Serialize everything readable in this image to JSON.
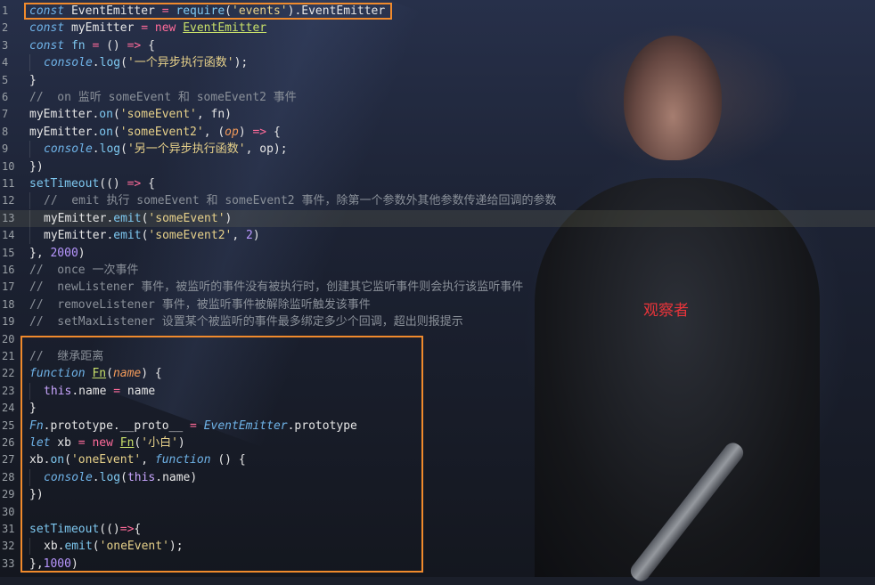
{
  "annotation": {
    "label": "观察者",
    "box_color": "#f08a2c",
    "label_color": "#e8343a"
  },
  "lines": [
    {
      "n": "1",
      "tokens": [
        [
          "kw",
          "const"
        ],
        [
          "code",
          " EventEmitter "
        ],
        [
          "op",
          "="
        ],
        [
          "code",
          " "
        ],
        [
          "fn",
          "require"
        ],
        [
          "code",
          "("
        ],
        [
          "str",
          "'events'"
        ],
        [
          "code",
          ").EventEmitter"
        ]
      ]
    },
    {
      "n": "2",
      "tokens": [
        [
          "kw",
          "const"
        ],
        [
          "code",
          " myEmitter "
        ],
        [
          "op",
          "="
        ],
        [
          "code",
          " "
        ],
        [
          "op",
          "new"
        ],
        [
          "code",
          " "
        ],
        [
          "cls",
          "EventEmitter"
        ]
      ]
    },
    {
      "n": "3",
      "tokens": [
        [
          "kw",
          "const"
        ],
        [
          "fn",
          " fn"
        ],
        [
          "code",
          " "
        ],
        [
          "op",
          "="
        ],
        [
          "code",
          " () "
        ],
        [
          "op",
          "=>"
        ],
        [
          "code",
          " {"
        ]
      ]
    },
    {
      "n": "4",
      "indent": 1,
      "tokens": [
        [
          "kw",
          "console"
        ],
        [
          "code",
          "."
        ],
        [
          "fn",
          "log"
        ],
        [
          "code",
          "("
        ],
        [
          "str",
          "'一个异步执行函数'"
        ],
        [
          "code",
          ");"
        ]
      ]
    },
    {
      "n": "5",
      "tokens": [
        [
          "code",
          "}"
        ]
      ]
    },
    {
      "n": "6",
      "tokens": [
        [
          "cm",
          "//  on 监听 someEvent 和 someEvent2 事件"
        ]
      ]
    },
    {
      "n": "7",
      "tokens": [
        [
          "code",
          "myEmitter."
        ],
        [
          "fn",
          "on"
        ],
        [
          "code",
          "("
        ],
        [
          "str",
          "'someEvent'"
        ],
        [
          "code",
          ", fn)"
        ]
      ]
    },
    {
      "n": "8",
      "tokens": [
        [
          "code",
          "myEmitter."
        ],
        [
          "fn",
          "on"
        ],
        [
          "code",
          "("
        ],
        [
          "str",
          "'someEvent2'"
        ],
        [
          "code",
          ", ("
        ],
        [
          "param",
          "op"
        ],
        [
          "code",
          ") "
        ],
        [
          "op",
          "=>"
        ],
        [
          "code",
          " {"
        ]
      ]
    },
    {
      "n": "9",
      "indent": 1,
      "tokens": [
        [
          "kw",
          "console"
        ],
        [
          "code",
          "."
        ],
        [
          "fn",
          "log"
        ],
        [
          "code",
          "("
        ],
        [
          "str",
          "'另一个异步执行函数'"
        ],
        [
          "code",
          ", op);"
        ]
      ]
    },
    {
      "n": "10",
      "tokens": [
        [
          "code",
          "})"
        ]
      ]
    },
    {
      "n": "11",
      "tokens": [
        [
          "fn",
          "setTimeout"
        ],
        [
          "code",
          "(() "
        ],
        [
          "op",
          "=>"
        ],
        [
          "code",
          " {"
        ]
      ]
    },
    {
      "n": "12",
      "indent": 1,
      "tokens": [
        [
          "cm",
          "//  emit 执行 someEvent 和 someEvent2 事件，除第一个参数外其他参数传递给回调的参数"
        ]
      ]
    },
    {
      "n": "13",
      "indent": 1,
      "active": true,
      "tokens": [
        [
          "code",
          "myEmitter."
        ],
        [
          "fn",
          "emit"
        ],
        [
          "code",
          "("
        ],
        [
          "str",
          "'someEvent'"
        ],
        [
          "code",
          ")"
        ]
      ]
    },
    {
      "n": "14",
      "indent": 1,
      "tokens": [
        [
          "code",
          "myEmitter."
        ],
        [
          "fn",
          "emit"
        ],
        [
          "code",
          "("
        ],
        [
          "str",
          "'someEvent2'"
        ],
        [
          "code",
          ", "
        ],
        [
          "num",
          "2"
        ],
        [
          "code",
          ")"
        ]
      ]
    },
    {
      "n": "15",
      "tokens": [
        [
          "code",
          "}, "
        ],
        [
          "num",
          "2000"
        ],
        [
          "code",
          ")"
        ]
      ]
    },
    {
      "n": "16",
      "tokens": [
        [
          "cm",
          "//  once 一次事件"
        ]
      ]
    },
    {
      "n": "17",
      "tokens": [
        [
          "cm",
          "//  newListener 事件，被监听的事件没有被执行时，创建其它监听事件则会执行该监听事件"
        ]
      ]
    },
    {
      "n": "18",
      "tokens": [
        [
          "cm",
          "//  removeListener 事件，被监听事件被解除监听触发该事件"
        ]
      ]
    },
    {
      "n": "19",
      "tokens": [
        [
          "cm",
          "//  setMaxListener 设置某个被监听的事件最多绑定多少个回调，超出则报提示"
        ]
      ]
    },
    {
      "n": "20",
      "tokens": []
    },
    {
      "n": "21",
      "tokens": [
        [
          "cm",
          "//  继承距离"
        ]
      ]
    },
    {
      "n": "22",
      "tokens": [
        [
          "kw",
          "function"
        ],
        [
          "code",
          " "
        ],
        [
          "cls",
          "Fn"
        ],
        [
          "code",
          "("
        ],
        [
          "param",
          "name"
        ],
        [
          "code",
          ") {"
        ]
      ]
    },
    {
      "n": "23",
      "indent": 1,
      "tokens": [
        [
          "this",
          "this"
        ],
        [
          "code",
          ".name "
        ],
        [
          "op",
          "="
        ],
        [
          "code",
          " name"
        ]
      ]
    },
    {
      "n": "24",
      "tokens": [
        [
          "code",
          "}"
        ]
      ]
    },
    {
      "n": "25",
      "tokens": [
        [
          "kw",
          "Fn"
        ],
        [
          "code",
          ".prototype.__proto__ "
        ],
        [
          "op",
          "="
        ],
        [
          "code",
          " "
        ],
        [
          "kw",
          "EventEmitter"
        ],
        [
          "code",
          ".prototype"
        ]
      ]
    },
    {
      "n": "26",
      "tokens": [
        [
          "kw",
          "let"
        ],
        [
          "code",
          " xb "
        ],
        [
          "op",
          "="
        ],
        [
          "code",
          " "
        ],
        [
          "op",
          "new"
        ],
        [
          "code",
          " "
        ],
        [
          "cls",
          "Fn"
        ],
        [
          "code",
          "("
        ],
        [
          "str",
          "'小白'"
        ],
        [
          "code",
          ")"
        ]
      ]
    },
    {
      "n": "27",
      "tokens": [
        [
          "code",
          "xb."
        ],
        [
          "fn",
          "on"
        ],
        [
          "code",
          "("
        ],
        [
          "str",
          "'oneEvent'"
        ],
        [
          "code",
          ", "
        ],
        [
          "kw",
          "function"
        ],
        [
          "code",
          " () {"
        ]
      ]
    },
    {
      "n": "28",
      "indent": 1,
      "tokens": [
        [
          "kw",
          "console"
        ],
        [
          "code",
          "."
        ],
        [
          "fn",
          "log"
        ],
        [
          "code",
          "("
        ],
        [
          "this",
          "this"
        ],
        [
          "code",
          ".name)"
        ]
      ]
    },
    {
      "n": "29",
      "tokens": [
        [
          "code",
          "})"
        ]
      ]
    },
    {
      "n": "30",
      "tokens": []
    },
    {
      "n": "31",
      "tokens": [
        [
          "fn",
          "setTimeout"
        ],
        [
          "code",
          "(()"
        ],
        [
          "op",
          "=>"
        ],
        [
          "code",
          "{"
        ]
      ]
    },
    {
      "n": "32",
      "indent": 1,
      "tokens": [
        [
          "code",
          "xb."
        ],
        [
          "fn",
          "emit"
        ],
        [
          "code",
          "("
        ],
        [
          "str",
          "'oneEvent'"
        ],
        [
          "code",
          ");"
        ]
      ]
    },
    {
      "n": "33",
      "tokens": [
        [
          "code",
          "},"
        ],
        [
          "num",
          "1000"
        ],
        [
          "code",
          ")"
        ]
      ]
    }
  ]
}
